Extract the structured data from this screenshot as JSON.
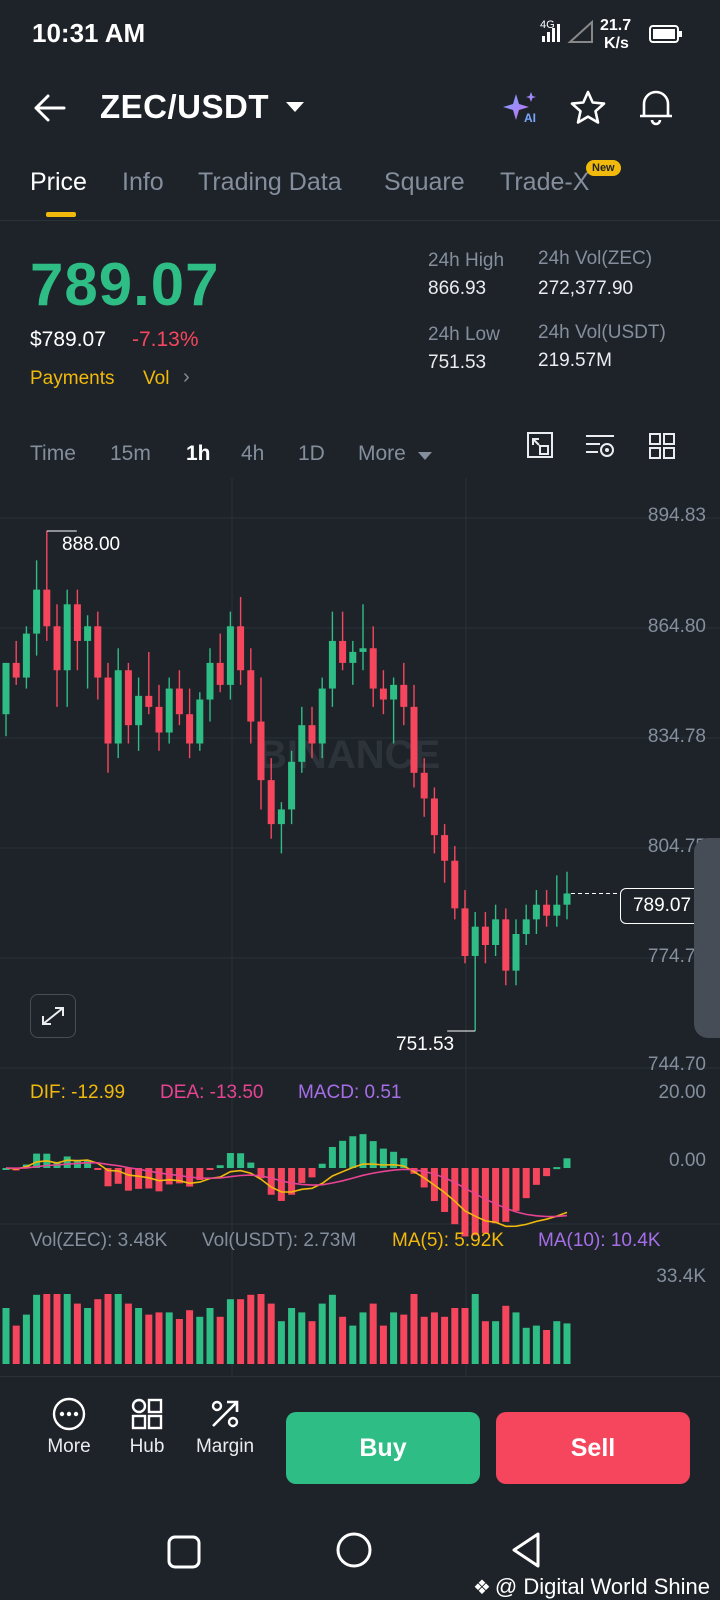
{
  "status_bar": {
    "time": "10:31 AM",
    "network": "4G",
    "speed_value": "21.7",
    "speed_unit": "K/s"
  },
  "header": {
    "pair": "ZEC/USDT",
    "icons": [
      "back-arrow-icon",
      "ai-sparkle-icon",
      "star-icon",
      "bell-icon"
    ]
  },
  "tabs": [
    {
      "label": "Price",
      "active": true
    },
    {
      "label": "Info",
      "active": false
    },
    {
      "label": "Trading Data",
      "active": false
    },
    {
      "label": "Square",
      "active": false
    },
    {
      "label": "Trade-X",
      "active": false,
      "badge": "New"
    }
  ],
  "price": {
    "last": "789.07",
    "usd": "$789.07",
    "change": "-7.13%",
    "tag_payments": "Payments",
    "tag_vol": "Vol",
    "color_up": "#2ebd85",
    "color_down": "#f6465d"
  },
  "stats": {
    "high_label": "24h High",
    "high_value": "866.93",
    "low_label": "24h Low",
    "low_value": "751.53",
    "vol_zec_label": "24h Vol(ZEC)",
    "vol_zec_value": "272,377.90",
    "vol_usdt_label": "24h Vol(USDT)",
    "vol_usdt_value": "219.57M"
  },
  "intervals": [
    {
      "label": "Time",
      "active": false
    },
    {
      "label": "15m",
      "active": false
    },
    {
      "label": "1h",
      "active": true
    },
    {
      "label": "4h",
      "active": false
    },
    {
      "label": "1D",
      "active": false
    },
    {
      "label": "More",
      "active": false
    }
  ],
  "chart_data": {
    "type": "candlestick",
    "interval": "1h",
    "price_axis": [
      "894.83",
      "864.80",
      "834.78",
      "804.75",
      "774.73",
      "744.70"
    ],
    "ylim": [
      744.7,
      894.83
    ],
    "high_marker": "888.00",
    "low_marker": "751.53",
    "current_price_label": "789.07",
    "watermark": "BINANCE",
    "candles": [
      {
        "o": 838,
        "h": 852,
        "l": 832,
        "c": 852
      },
      {
        "o": 852,
        "h": 858,
        "l": 846,
        "c": 848
      },
      {
        "o": 848,
        "h": 862,
        "l": 845,
        "c": 860
      },
      {
        "o": 860,
        "h": 880,
        "l": 854,
        "c": 872
      },
      {
        "o": 872,
        "h": 888,
        "l": 858,
        "c": 862
      },
      {
        "o": 862,
        "h": 868,
        "l": 840,
        "c": 850
      },
      {
        "o": 850,
        "h": 872,
        "l": 840,
        "c": 868
      },
      {
        "o": 868,
        "h": 872,
        "l": 850,
        "c": 858
      },
      {
        "o": 858,
        "h": 865,
        "l": 845,
        "c": 862
      },
      {
        "o": 862,
        "h": 866,
        "l": 842,
        "c": 848
      },
      {
        "o": 848,
        "h": 852,
        "l": 822,
        "c": 830
      },
      {
        "o": 830,
        "h": 856,
        "l": 826,
        "c": 850
      },
      {
        "o": 850,
        "h": 852,
        "l": 830,
        "c": 835
      },
      {
        "o": 835,
        "h": 848,
        "l": 828,
        "c": 843
      },
      {
        "o": 843,
        "h": 855,
        "l": 838,
        "c": 840
      },
      {
        "o": 840,
        "h": 846,
        "l": 828,
        "c": 833
      },
      {
        "o": 833,
        "h": 848,
        "l": 830,
        "c": 845
      },
      {
        "o": 845,
        "h": 850,
        "l": 835,
        "c": 838
      },
      {
        "o": 838,
        "h": 845,
        "l": 826,
        "c": 830
      },
      {
        "o": 830,
        "h": 844,
        "l": 828,
        "c": 842
      },
      {
        "o": 842,
        "h": 856,
        "l": 836,
        "c": 852
      },
      {
        "o": 852,
        "h": 860,
        "l": 844,
        "c": 846
      },
      {
        "o": 846,
        "h": 866,
        "l": 842,
        "c": 862
      },
      {
        "o": 862,
        "h": 870,
        "l": 846,
        "c": 850
      },
      {
        "o": 850,
        "h": 856,
        "l": 830,
        "c": 836
      },
      {
        "o": 836,
        "h": 848,
        "l": 812,
        "c": 820
      },
      {
        "o": 820,
        "h": 826,
        "l": 804,
        "c": 808
      },
      {
        "o": 808,
        "h": 814,
        "l": 800,
        "c": 812
      },
      {
        "o": 812,
        "h": 828,
        "l": 808,
        "c": 825
      },
      {
        "o": 825,
        "h": 840,
        "l": 822,
        "c": 835
      },
      {
        "o": 835,
        "h": 840,
        "l": 826,
        "c": 830
      },
      {
        "o": 830,
        "h": 848,
        "l": 826,
        "c": 845
      },
      {
        "o": 845,
        "h": 866,
        "l": 840,
        "c": 858
      },
      {
        "o": 858,
        "h": 866,
        "l": 850,
        "c": 852
      },
      {
        "o": 852,
        "h": 858,
        "l": 846,
        "c": 855
      },
      {
        "o": 855,
        "h": 868,
        "l": 850,
        "c": 856
      },
      {
        "o": 856,
        "h": 862,
        "l": 840,
        "c": 845
      },
      {
        "o": 845,
        "h": 850,
        "l": 838,
        "c": 842
      },
      {
        "o": 842,
        "h": 848,
        "l": 830,
        "c": 846
      },
      {
        "o": 846,
        "h": 852,
        "l": 835,
        "c": 840
      },
      {
        "o": 840,
        "h": 846,
        "l": 818,
        "c": 822
      },
      {
        "o": 822,
        "h": 826,
        "l": 810,
        "c": 815
      },
      {
        "o": 815,
        "h": 818,
        "l": 800,
        "c": 805
      },
      {
        "o": 805,
        "h": 808,
        "l": 792,
        "c": 798
      },
      {
        "o": 798,
        "h": 802,
        "l": 782,
        "c": 785
      },
      {
        "o": 785,
        "h": 790,
        "l": 770,
        "c": 772
      },
      {
        "o": 772,
        "h": 784,
        "l": 751.53,
        "c": 780
      },
      {
        "o": 780,
        "h": 784,
        "l": 770,
        "c": 775
      },
      {
        "o": 775,
        "h": 786,
        "l": 772,
        "c": 782
      },
      {
        "o": 782,
        "h": 785,
        "l": 764,
        "c": 768
      },
      {
        "o": 768,
        "h": 782,
        "l": 764,
        "c": 778
      },
      {
        "o": 778,
        "h": 786,
        "l": 775,
        "c": 782
      },
      {
        "o": 782,
        "h": 790,
        "l": 778,
        "c": 786
      },
      {
        "o": 786,
        "h": 790,
        "l": 780,
        "c": 783
      },
      {
        "o": 783,
        "h": 794,
        "l": 780,
        "c": 786
      },
      {
        "o": 786,
        "h": 795,
        "l": 782,
        "c": 789.07
      }
    ],
    "macd": {
      "dif_label": "DIF: -12.99",
      "dea_label": "DEA: -13.50",
      "macd_label": "MACD: 0.51",
      "axis": [
        "20.00",
        "0.00"
      ]
    },
    "volume": {
      "vol_zec_label": "Vol(ZEC): 3.48K",
      "vol_usdt_label": "Vol(USDT): 2.73M",
      "ma5_label": "MA(5): 5.92K",
      "ma10_label": "MA(10): 10.4K",
      "axis_top": "33.4K"
    }
  },
  "bottom": {
    "more": "More",
    "hub": "Hub",
    "margin": "Margin",
    "buy": "Buy",
    "sell": "Sell"
  },
  "watermark_text": "@ Digital World Shine"
}
